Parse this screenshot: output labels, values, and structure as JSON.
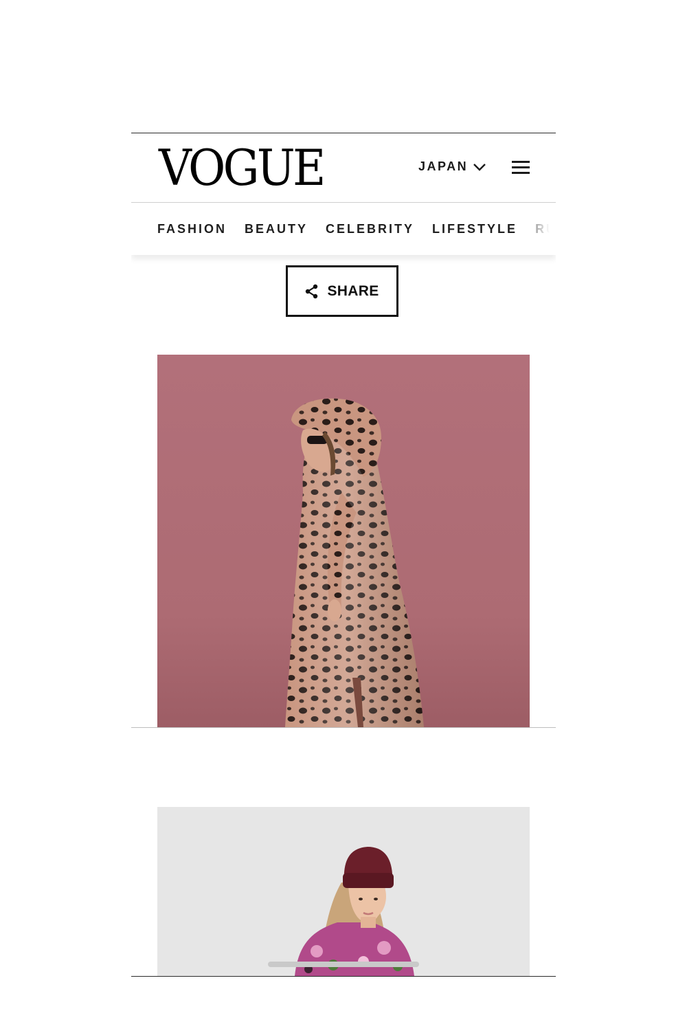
{
  "header": {
    "logo": "VOGUE",
    "edition": "JAPAN",
    "edition_icon": "chevron-down-icon",
    "menu_icon": "hamburger-menu-icon"
  },
  "nav": {
    "items": [
      {
        "label": "FASHION"
      },
      {
        "label": "BEAUTY"
      },
      {
        "label": "CELEBRITY"
      },
      {
        "label": "LIFESTYLE"
      },
      {
        "label": "RU"
      }
    ]
  },
  "share": {
    "label": "SHARE",
    "icon": "share-icon"
  },
  "gallery": {
    "images": [
      {
        "subject": "model in leopard print hooded rain poncho",
        "background": "#b0707a"
      },
      {
        "subject": "model in burgundy beanie and floral jacket",
        "background": "#e6e6e6"
      }
    ]
  },
  "colors": {
    "text": "#1a1a1a",
    "photo1_bg": "#b0707a",
    "photo2_bg": "#e6e6e6",
    "beanie": "#6b1f2a"
  }
}
